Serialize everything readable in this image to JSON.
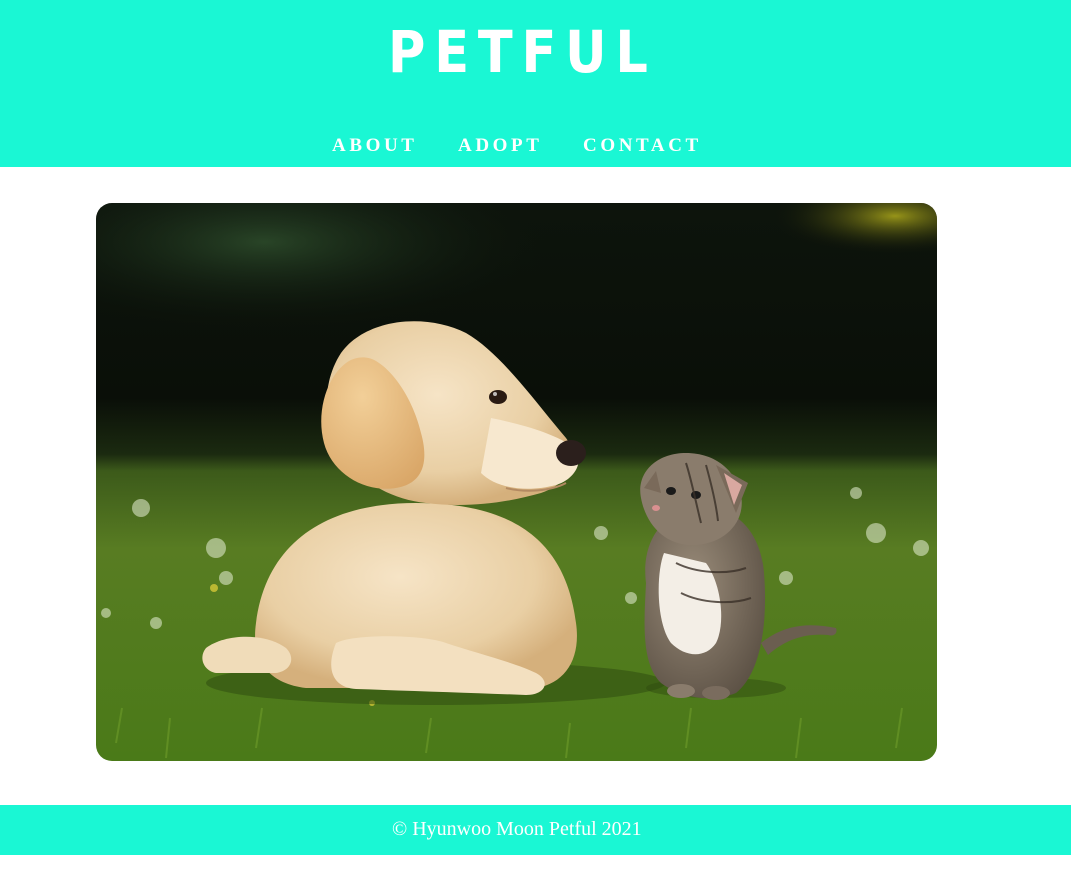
{
  "header": {
    "logo": "PETFUL",
    "nav": [
      {
        "label": "ABOUT"
      },
      {
        "label": "ADOPT"
      },
      {
        "label": "CONTACT"
      }
    ]
  },
  "hero": {
    "image": "puppy-and-kitten-photo"
  },
  "footer": {
    "copyright": "© Hyunwoo Moon Petful 2021"
  },
  "colors": {
    "accent": "#1af7d4",
    "text_on_accent": "#ffffff"
  }
}
